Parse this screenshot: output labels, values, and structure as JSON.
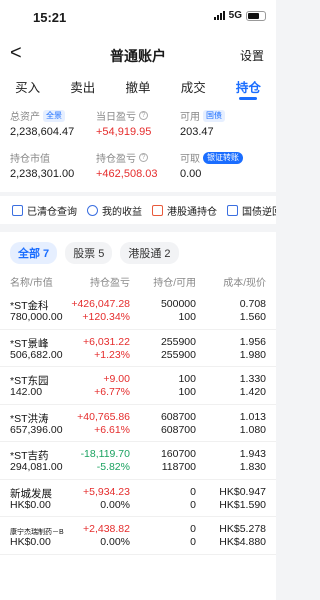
{
  "status_bar": {
    "time": "15:21",
    "network": "5G"
  },
  "header": {
    "back_label": "<",
    "title": "普通账户",
    "settings_label": "设置"
  },
  "tabs": [
    {
      "label": "买入"
    },
    {
      "label": "卖出"
    },
    {
      "label": "撤单"
    },
    {
      "label": "成交"
    },
    {
      "label": "持仓",
      "active": true
    }
  ],
  "summary": {
    "total_assets": {
      "label": "总资产",
      "badge": "全景",
      "value": "2,238,604.47"
    },
    "daily_pnl": {
      "label": "当日盈亏",
      "value": "+54,919.95"
    },
    "available": {
      "label": "可用",
      "badge": "国债",
      "value": "203.47"
    },
    "market_value": {
      "label": "持仓市值",
      "value": "2,238,301.00"
    },
    "position_pnl": {
      "label": "持仓盈亏",
      "value": "+462,508.03"
    },
    "withdrawable": {
      "label": "可取",
      "badge": "银证转账",
      "value": "0.00"
    }
  },
  "quick_actions": [
    {
      "label": "已清仓查询",
      "icon": "clipboard-icon"
    },
    {
      "label": "我的收益",
      "icon": "chart-icon"
    },
    {
      "label": "港股通持仓",
      "icon": "house-icon"
    },
    {
      "label": "国债逆回",
      "icon": "bond-icon"
    }
  ],
  "filters": [
    {
      "label": "全部 7",
      "active": true
    },
    {
      "label": "股票 5"
    },
    {
      "label": "港股通 2"
    }
  ],
  "table": {
    "headers": {
      "name": "名称/市值",
      "pnl": "持仓盈亏",
      "position": "持仓/可用",
      "cost": "成本/现价"
    },
    "rows": [
      {
        "name": "*ST金科",
        "market_value": "780,000.00",
        "pnl": "+426,047.28",
        "pnl_pct": "+120.34%",
        "position": "500000",
        "available": "100",
        "cost": "0.708",
        "price": "1.560",
        "trend": "up"
      },
      {
        "name": "*ST景峰",
        "market_value": "506,682.00",
        "pnl": "+6,031.22",
        "pnl_pct": "+1.23%",
        "position": "255900",
        "available": "255900",
        "cost": "1.956",
        "price": "1.980",
        "trend": "up"
      },
      {
        "name": "*ST东园",
        "market_value": "142.00",
        "pnl": "+9.00",
        "pnl_pct": "+6.77%",
        "position": "100",
        "available": "100",
        "cost": "1.330",
        "price": "1.420",
        "trend": "up"
      },
      {
        "name": "*ST洪涛",
        "market_value": "657,396.00",
        "pnl": "+40,765.86",
        "pnl_pct": "+6.61%",
        "position": "608700",
        "available": "608700",
        "cost": "1.013",
        "price": "1.080",
        "trend": "up"
      },
      {
        "name": "*ST吉药",
        "market_value": "294,081.00",
        "pnl": "-18,119.70",
        "pnl_pct": "-5.82%",
        "position": "160700",
        "available": "118700",
        "cost": "1.943",
        "price": "1.830",
        "trend": "down"
      },
      {
        "name": "新城发展",
        "market_value": "HK$0.00",
        "pnl": "+5,934.23",
        "pnl_pct": "0.00%",
        "position": "0",
        "available": "0",
        "cost": "HK$0.947",
        "price": "HK$1.590",
        "trend": "up"
      },
      {
        "name": "康宁杰瑞制药－B",
        "market_value": "HK$0.00",
        "pnl": "+2,438.82",
        "pnl_pct": "0.00%",
        "position": "0",
        "available": "0",
        "cost": "HK$5.278",
        "price": "HK$4.880",
        "trend": "up",
        "small": true
      }
    ]
  },
  "colors": {
    "accent": "#1a6dff",
    "up": "#e52d2d",
    "down": "#1aa260"
  }
}
